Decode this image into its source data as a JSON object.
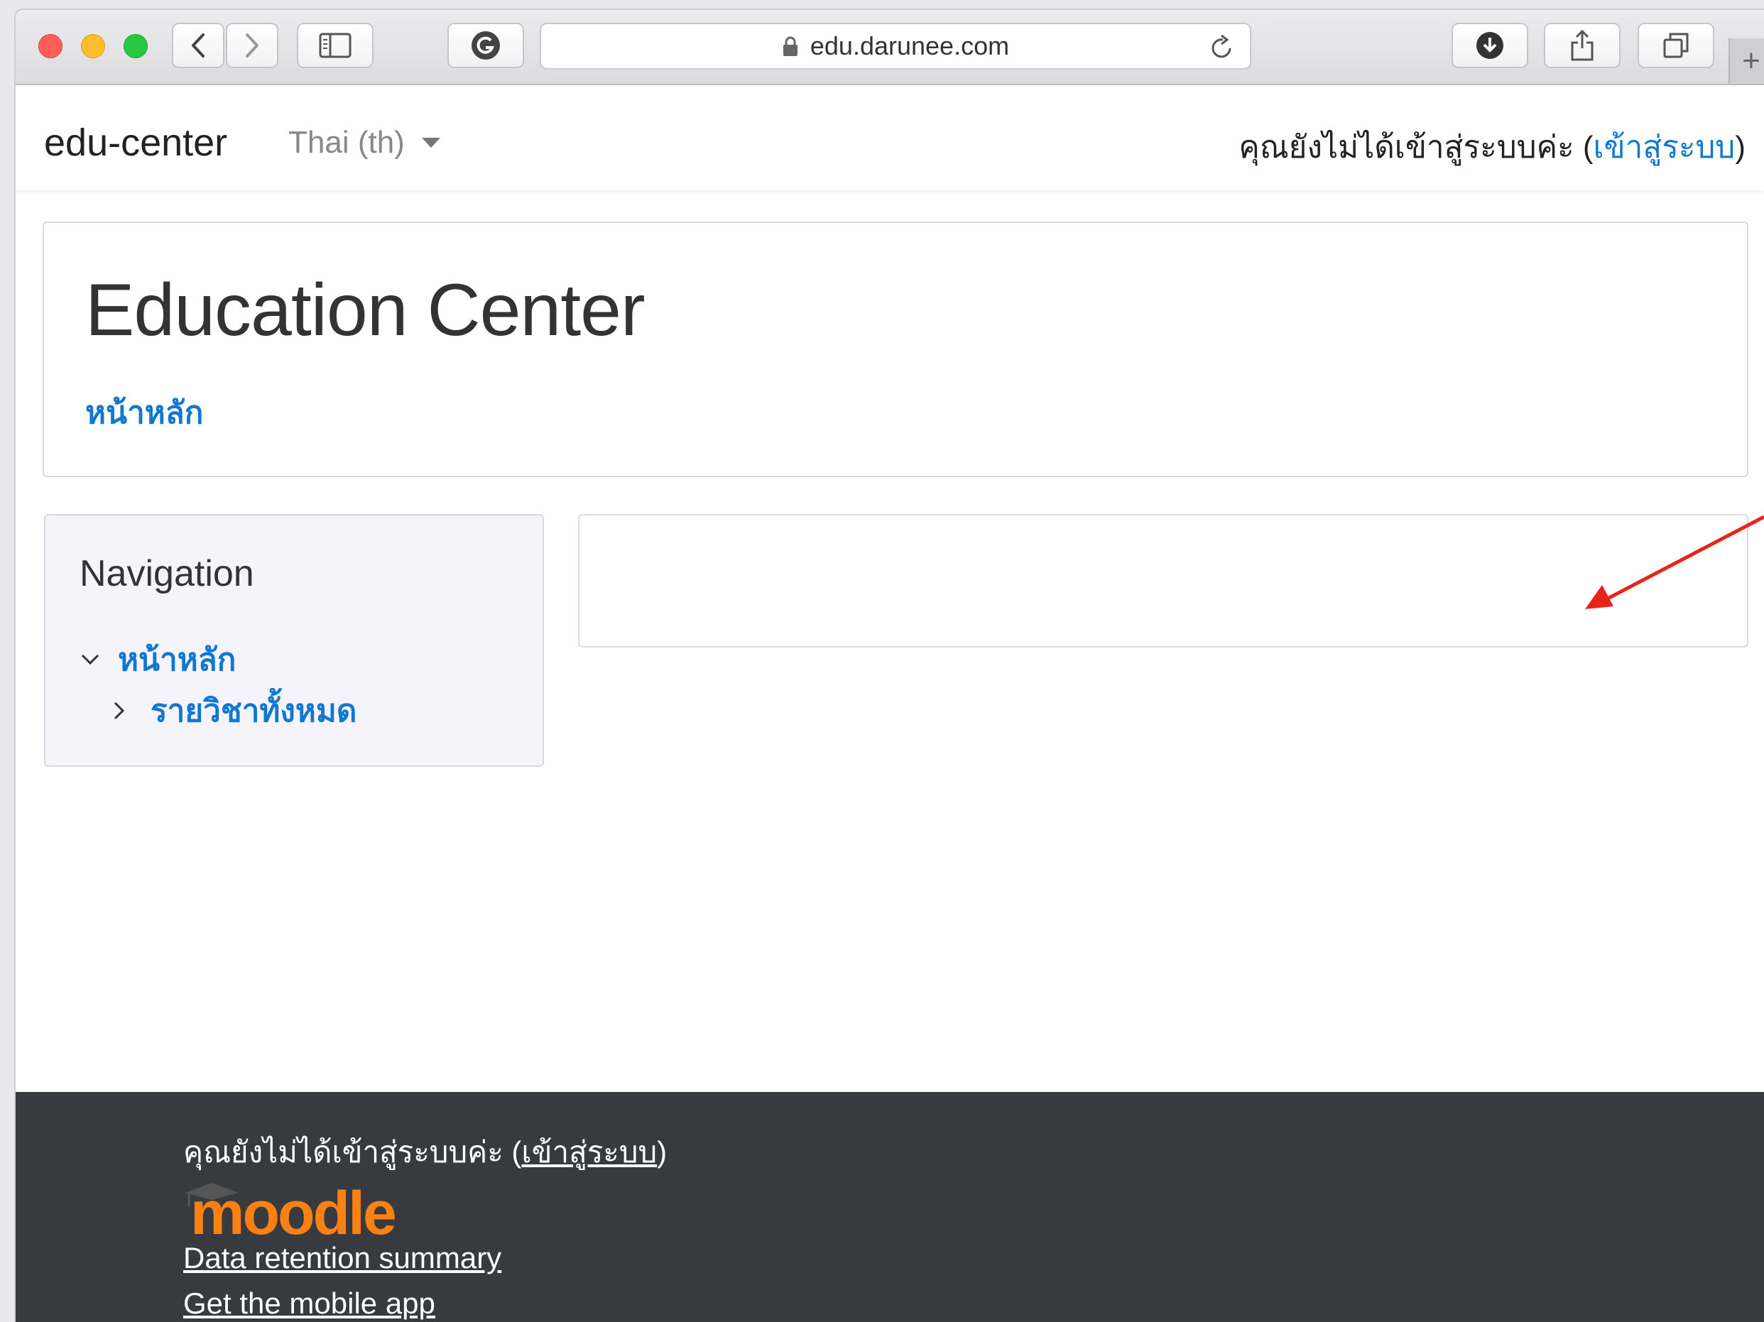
{
  "browser": {
    "url": "edu.darunee.com",
    "new_tab_symbol": "+"
  },
  "navbar": {
    "brand": "edu-center",
    "language": "Thai (th)",
    "login_text": "คุณยังไม่ได้เข้าสู่ระบบค่ะ (",
    "login_link": "เข้าสู่ระบบ",
    "login_close": ")"
  },
  "header": {
    "title": "Education Center",
    "breadcrumb": "หน้าหลัก"
  },
  "navigation": {
    "title": "Navigation",
    "items": [
      {
        "label": "หน้าหลัก"
      },
      {
        "label": "รายวิชาทั้งหมด"
      }
    ]
  },
  "footer": {
    "login_text": "คุณยังไม่ได้เข้าสู่ระบบค่ะ (",
    "login_link": "เข้าสู่ระบบ",
    "login_close": ")",
    "logo_text": "moodle",
    "links": [
      "Data retention summary",
      "Get the mobile app"
    ]
  },
  "colors": {
    "link": "#1177d1",
    "footer_bg": "#373a3f",
    "moodle_orange": "#f98012",
    "annotation_arrow": "#e8231a"
  }
}
